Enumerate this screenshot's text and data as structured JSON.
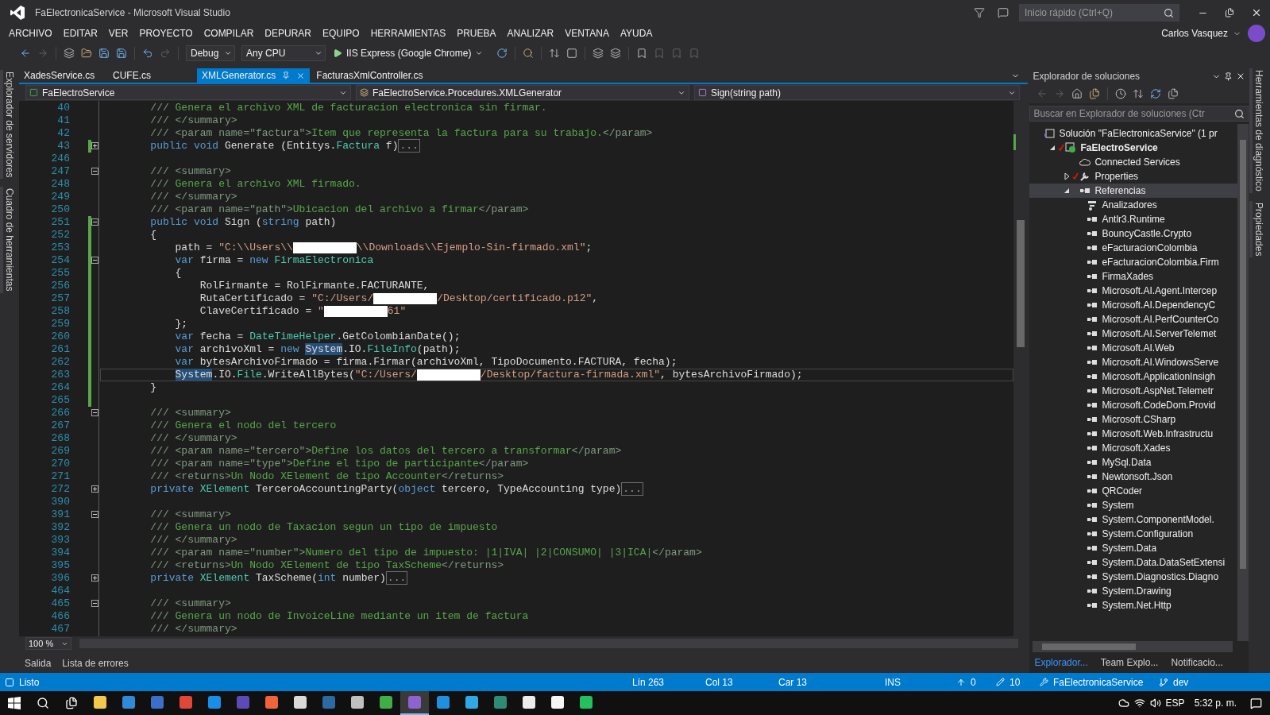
{
  "window": {
    "title": "FaElectronicaService - Microsoft Visual Studio",
    "quick_launch_placeholder": "Inicio rápido (Ctrl+Q)",
    "user": "Carlos Vasquez"
  },
  "menu": [
    "ARCHIVO",
    "EDITAR",
    "VER",
    "PROYECTO",
    "COMPILAR",
    "DEPURAR",
    "EQUIPO",
    "HERRAMIENTAS",
    "PRUEBA",
    "ANALIZAR",
    "VENTANA",
    "AYUDA"
  ],
  "toolbar": {
    "configuration": "Debug",
    "platform": "Any CPU",
    "run": "IIS Express (Google Chrome)"
  },
  "left_tabs": [
    "Explorador de servidores",
    "Cuadro de herramientas"
  ],
  "right_tabs": [
    "Herramientas de diagnóstico",
    "Propiedades"
  ],
  "doc_tabs": [
    {
      "label": "XadesService.cs",
      "selected": false
    },
    {
      "label": "CUFE.cs",
      "selected": false
    },
    {
      "label": "XMLGenerator.cs",
      "selected": true
    },
    {
      "label": "FacturasXmlController.cs",
      "selected": false
    }
  ],
  "nav_bar": {
    "project": "FaElectroService",
    "class": "FaElectroService.Procedures.XMLGenerator",
    "member": "Sign(string path)"
  },
  "editor": {
    "lines": [
      {
        "n": "40",
        "collapsible": false,
        "collapsed": false,
        "changed": false,
        "current": false,
        "tokens": [
          {
            "kind": "dt",
            "text": "///"
          },
          {
            "kind": "cm",
            "text": " Genera el archivo XML de facturacion electronica sin firmar."
          }
        ]
      },
      {
        "n": "41",
        "collapsible": false,
        "collapsed": false,
        "changed": false,
        "current": false,
        "tokens": [
          {
            "kind": "dt",
            "text": "/// </summary>"
          }
        ]
      },
      {
        "n": "42",
        "collapsible": false,
        "collapsed": false,
        "changed": false,
        "current": false,
        "tokens": [
          {
            "kind": "dt",
            "text": "/// <param name=\"factura\">"
          },
          {
            "kind": "cm",
            "text": "Item que representa la factura para su trabajo."
          },
          {
            "kind": "dt",
            "text": "</param>"
          }
        ]
      },
      {
        "n": "43",
        "collapsible": true,
        "collapsed": true,
        "changed": true,
        "current": false,
        "tokens": [
          {
            "kind": "kw",
            "text": "public void"
          },
          {
            "kind": "p",
            "text": " Generate (Entitys."
          },
          {
            "kind": "ty",
            "text": "Factura"
          },
          {
            "kind": "p",
            "text": " f)"
          },
          {
            "kind": "col",
            "text": "..."
          }
        ]
      },
      {
        "n": "246",
        "collapsible": false,
        "collapsed": false,
        "changed": false,
        "current": false
      },
      {
        "n": "247",
        "collapsible": true,
        "collapsed": false,
        "changed": false,
        "current": false,
        "tokens": [
          {
            "kind": "dt",
            "text": "/// <summary>"
          }
        ]
      },
      {
        "n": "248",
        "collapsible": false,
        "collapsed": false,
        "changed": false,
        "current": false,
        "tokens": [
          {
            "kind": "dt",
            "text": "///"
          },
          {
            "kind": "cm",
            "text": " Genera el archivo XML firmado."
          }
        ]
      },
      {
        "n": "249",
        "collapsible": false,
        "collapsed": false,
        "changed": false,
        "current": false,
        "tokens": [
          {
            "kind": "dt",
            "text": "/// </summary>"
          }
        ]
      },
      {
        "n": "250",
        "collapsible": false,
        "collapsed": false,
        "changed": false,
        "current": false,
        "tokens": [
          {
            "kind": "dt",
            "text": "/// <param name=\"path\">"
          },
          {
            "kind": "cm",
            "text": "Ubicacion del archivo a firmar"
          },
          {
            "kind": "dt",
            "text": "</param>"
          }
        ]
      },
      {
        "n": "251",
        "collapsible": true,
        "collapsed": false,
        "changed": true,
        "current": false,
        "tokens": [
          {
            "kind": "kw",
            "text": "public void"
          },
          {
            "kind": "p",
            "text": " Sign ("
          },
          {
            "kind": "kw",
            "text": "string"
          },
          {
            "kind": "p",
            "text": " path)"
          }
        ]
      },
      {
        "n": "252",
        "collapsible": false,
        "collapsed": false,
        "changed": true,
        "current": false,
        "tokens": [
          {
            "kind": "p",
            "text": "{"
          }
        ],
        "children": [
          {
            "n": "253",
            "collapsible": false,
            "collapsed": false,
            "changed": true,
            "current": false,
            "tokens": [
              {
                "kind": "p",
                "text": "path = "
              },
              {
                "kind": "st",
                "text": "\"C:\\\\Users\\\\"
              },
              {
                "kind": "redacted"
              },
              {
                "kind": "st",
                "text": "\\\\Downloads\\\\Ejemplo-Sin-firmado.xml\""
              },
              {
                "kind": "p",
                "text": ";"
              }
            ]
          },
          {
            "n": "254",
            "collapsible": true,
            "collapsed": false,
            "changed": true,
            "current": false,
            "tokens": [
              {
                "kind": "kw",
                "text": "var"
              },
              {
                "kind": "p",
                "text": " firma = "
              },
              {
                "kind": "kw",
                "text": "new"
              },
              {
                "kind": "ty",
                "text": " FirmaElectronica"
              }
            ]
          },
          {
            "n": "255",
            "collapsible": false,
            "collapsed": false,
            "changed": true,
            "current": false,
            "tokens": [
              {
                "kind": "p",
                "text": "{"
              }
            ],
            "children": [
              {
                "n": "256",
                "collapsible": false,
                "collapsed": false,
                "changed": true,
                "current": false,
                "tokens": [
                  {
                    "kind": "p",
                    "text": "RolFirmante = RolFirmante.FACTURANTE,"
                  }
                ]
              },
              {
                "n": "257",
                "collapsible": false,
                "collapsed": false,
                "changed": true,
                "current": false,
                "tokens": [
                  {
                    "kind": "p",
                    "text": "RutaCertificado = "
                  },
                  {
                    "kind": "st",
                    "text": "\"C:/Users/"
                  },
                  {
                    "kind": "redacted"
                  },
                  {
                    "kind": "st",
                    "text": "/Desktop/certificado.p12\""
                  },
                  {
                    "kind": "p",
                    "text": ","
                  }
                ]
              },
              {
                "n": "258",
                "collapsible": false,
                "collapsed": false,
                "changed": true,
                "current": false,
                "tokens": [
                  {
                    "kind": "p",
                    "text": "ClaveCertificado = "
                  },
                  {
                    "kind": "st",
                    "text": "\""
                  },
                  {
                    "kind": "redacted"
                  },
                  {
                    "kind": "st",
                    "text": "61\""
                  }
                ]
              }
            ]
          },
          {
            "n": "259",
            "collapsible": false,
            "collapsed": false,
            "changed": true,
            "current": false,
            "tokens": [
              {
                "kind": "p",
                "text": "};"
              }
            ]
          },
          {
            "n": "260",
            "collapsible": false,
            "collapsed": false,
            "changed": true,
            "current": false,
            "tokens": [
              {
                "kind": "kw",
                "text": "var"
              },
              {
                "kind": "p",
                "text": " fecha = "
              },
              {
                "kind": "ty",
                "text": "DateTimeHelper"
              },
              {
                "kind": "p",
                "text": ".GetColombianDate();"
              }
            ]
          },
          {
            "n": "261",
            "collapsible": false,
            "collapsed": false,
            "changed": true,
            "current": false,
            "tokens": [
              {
                "kind": "kw",
                "text": "var"
              },
              {
                "kind": "p",
                "text": " archivoXml = "
              },
              {
                "kind": "kw",
                "text": "new "
              },
              {
                "kind": "ref",
                "text": "System"
              },
              {
                "kind": "p",
                "text": ".IO."
              },
              {
                "kind": "ty",
                "text": "FileInfo"
              },
              {
                "kind": "p",
                "text": "(path);"
              }
            ]
          },
          {
            "n": "262",
            "collapsible": false,
            "collapsed": false,
            "changed": true,
            "current": false,
            "tokens": [
              {
                "kind": "kw",
                "text": "var"
              },
              {
                "kind": "p",
                "text": " bytesArchivoFirmado = firma.Firmar(archivoXml, TipoDocumento.FACTURA, fecha);"
              }
            ]
          },
          {
            "n": "263",
            "collapsible": false,
            "collapsed": false,
            "changed": true,
            "current": true,
            "tokens": [
              {
                "kind": "ref",
                "text": "System"
              },
              {
                "kind": "p",
                "text": ".IO."
              },
              {
                "kind": "ty",
                "text": "File"
              },
              {
                "kind": "p",
                "text": ".WriteAllBytes("
              },
              {
                "kind": "st",
                "text": "\"C:/Users/"
              },
              {
                "kind": "redacted"
              },
              {
                "kind": "st",
                "text": "/Desktop/factura-firmada.xml\""
              },
              {
                "kind": "p",
                "text": ", bytesArchivoFirmado);"
              }
            ]
          }
        ]
      },
      {
        "n": "264",
        "collapsible": false,
        "collapsed": false,
        "changed": true,
        "current": false,
        "tokens": [
          {
            "kind": "p",
            "text": "}"
          }
        ]
      },
      {
        "n": "265",
        "collapsible": false,
        "collapsed": false,
        "changed": true,
        "current": false
      },
      {
        "n": "266",
        "collapsible": true,
        "collapsed": false,
        "changed": false,
        "current": false,
        "tokens": [
          {
            "kind": "dt",
            "text": "/// <summary>"
          }
        ]
      },
      {
        "n": "267",
        "collapsible": false,
        "collapsed": false,
        "changed": false,
        "current": false,
        "tokens": [
          {
            "kind": "dt",
            "text": "///"
          },
          {
            "kind": "cm",
            "text": " Genera el nodo del tercero"
          }
        ]
      },
      {
        "n": "268",
        "collapsible": false,
        "collapsed": false,
        "changed": false,
        "current": false,
        "tokens": [
          {
            "kind": "dt",
            "text": "/// </summary>"
          }
        ]
      },
      {
        "n": "269",
        "collapsible": false,
        "collapsed": false,
        "changed": false,
        "current": false,
        "tokens": [
          {
            "kind": "dt",
            "text": "/// <param name=\"tercero\">"
          },
          {
            "kind": "cm",
            "text": "Define los datos del tercero a transformar"
          },
          {
            "kind": "dt",
            "text": "</param>"
          }
        ]
      },
      {
        "n": "270",
        "collapsible": false,
        "collapsed": false,
        "changed": false,
        "current": false,
        "tokens": [
          {
            "kind": "dt",
            "text": "/// <param name=\"type\">"
          },
          {
            "kind": "cm",
            "text": "Define el tipo de participante"
          },
          {
            "kind": "dt",
            "text": "</param>"
          }
        ]
      },
      {
        "n": "271",
        "collapsible": false,
        "collapsed": false,
        "changed": false,
        "current": false,
        "tokens": [
          {
            "kind": "dt",
            "text": "/// <returns>"
          },
          {
            "kind": "cm",
            "text": "Un Nodo XElement de tipo Accounter"
          },
          {
            "kind": "dt",
            "text": "</returns>"
          }
        ]
      },
      {
        "n": "272",
        "collapsible": true,
        "collapsed": true,
        "changed": false,
        "current": false,
        "tokens": [
          {
            "kind": "kw",
            "text": "private"
          },
          {
            "kind": "ty",
            "text": " XElement"
          },
          {
            "kind": "p",
            "text": " TerceroAccountingParty("
          },
          {
            "kind": "kw",
            "text": "object"
          },
          {
            "kind": "p",
            "text": " tercero, TypeAccounting type)"
          },
          {
            "kind": "col",
            "text": "..."
          }
        ]
      },
      {
        "n": "390",
        "collapsible": false,
        "collapsed": false,
        "changed": false,
        "current": false
      },
      {
        "n": "391",
        "collapsible": true,
        "collapsed": false,
        "changed": false,
        "current": false,
        "tokens": [
          {
            "kind": "dt",
            "text": "/// <summary>"
          }
        ]
      },
      {
        "n": "392",
        "collapsible": false,
        "collapsed": false,
        "changed": false,
        "current": false,
        "tokens": [
          {
            "kind": "dt",
            "text": "///"
          },
          {
            "kind": "cm",
            "text": " Genera un nodo de Taxacion segun un tipo de impuesto"
          }
        ]
      },
      {
        "n": "393",
        "collapsible": false,
        "collapsed": false,
        "changed": false,
        "current": false,
        "tokens": [
          {
            "kind": "dt",
            "text": "/// </summary>"
          }
        ]
      },
      {
        "n": "394",
        "collapsible": false,
        "collapsed": false,
        "changed": false,
        "current": false,
        "tokens": [
          {
            "kind": "dt",
            "text": "/// <param name=\"number\">"
          },
          {
            "kind": "cm",
            "text": "Numero del tipo de impuesto: |1|IVA| |2|CONSUMO| |3|ICA|"
          },
          {
            "kind": "dt",
            "text": "</param>"
          }
        ]
      },
      {
        "n": "395",
        "collapsible": false,
        "collapsed": false,
        "changed": false,
        "current": false,
        "tokens": [
          {
            "kind": "dt",
            "text": "/// <returns>"
          },
          {
            "kind": "cm",
            "text": "Un Nodo XElement de tipo TaxScheme"
          },
          {
            "kind": "dt",
            "text": "</returns>"
          }
        ]
      },
      {
        "n": "396",
        "collapsible": true,
        "collapsed": true,
        "changed": false,
        "current": false,
        "tokens": [
          {
            "kind": "kw",
            "text": "private"
          },
          {
            "kind": "ty",
            "text": " XElement"
          },
          {
            "kind": "p",
            "text": " TaxScheme("
          },
          {
            "kind": "kw",
            "text": "int"
          },
          {
            "kind": "p",
            "text": " number)"
          },
          {
            "kind": "col",
            "text": "..."
          }
        ]
      },
      {
        "n": "464",
        "collapsible": false,
        "collapsed": false,
        "changed": false,
        "current": false
      },
      {
        "n": "465",
        "collapsible": true,
        "collapsed": false,
        "changed": false,
        "current": false,
        "tokens": [
          {
            "kind": "dt",
            "text": "/// <summary>"
          }
        ]
      },
      {
        "n": "466",
        "collapsible": false,
        "collapsed": false,
        "changed": false,
        "current": false,
        "tokens": [
          {
            "kind": "dt",
            "text": "///"
          },
          {
            "kind": "cm",
            "text": " Genera un nodo de InvoiceLine mediante un item de factura"
          }
        ]
      },
      {
        "n": "467",
        "collapsible": false,
        "collapsed": false,
        "changed": false,
        "current": false,
        "tokens": [
          {
            "kind": "dt",
            "text": "/// </summary>"
          }
        ]
      }
    ],
    "zoom": "100 %"
  },
  "output_tabs": [
    {
      "label": "Salida",
      "selected": false
    },
    {
      "label": "Lista de errores",
      "selected": false
    }
  ],
  "solution_explorer": {
    "title": "Explorador de soluciones",
    "search_placeholder": "Buscar en Explorador de soluciones (Ctr",
    "tree": [
      {
        "label": "Solución \"FaElectronicaService\"  (1 pr",
        "kind": "solution",
        "selected": false,
        "children": [
          {
            "label": "FaElectroService",
            "kind": "project",
            "selected": false,
            "expanded": true,
            "modified": true,
            "children": [
              {
                "label": "Connected Services",
                "kind": "service",
                "selected": false,
                "modified": false
              },
              {
                "label": "Properties",
                "kind": "properties",
                "selected": false,
                "expanded": false,
                "modified": true
              },
              {
                "label": "Referencias",
                "kind": "references",
                "selected": true,
                "expanded": true,
                "modified": false,
                "children": [
                  {
                    "label": "Analizadores",
                    "kind": "analyzers",
                    "selected": false
                  },
                  {
                    "label": "Antlr3.Runtime",
                    "kind": "reference",
                    "selected": false
                  },
                  {
                    "label": "BouncyCastle.Crypto",
                    "kind": "reference",
                    "selected": false
                  },
                  {
                    "label": "eFacturacionColombia",
                    "kind": "reference",
                    "selected": false
                  },
                  {
                    "label": "eFacturacionColombia.Firm",
                    "kind": "reference",
                    "selected": false
                  },
                  {
                    "label": "FirmaXades",
                    "kind": "reference",
                    "selected": false
                  },
                  {
                    "label": "Microsoft.AI.Agent.Intercep",
                    "kind": "reference",
                    "selected": false
                  },
                  {
                    "label": "Microsoft.AI.DependencyC",
                    "kind": "reference",
                    "selected": false
                  },
                  {
                    "label": "Microsoft.AI.PerfCounterCo",
                    "kind": "reference",
                    "selected": false
                  },
                  {
                    "label": "Microsoft.AI.ServerTelemet",
                    "kind": "reference",
                    "selected": false
                  },
                  {
                    "label": "Microsoft.AI.Web",
                    "kind": "reference",
                    "selected": false
                  },
                  {
                    "label": "Microsoft.AI.WindowsServe",
                    "kind": "reference",
                    "selected": false
                  },
                  {
                    "label": "Microsoft.ApplicationInsigh",
                    "kind": "reference",
                    "selected": false
                  },
                  {
                    "label": "Microsoft.AspNet.Telemetr",
                    "kind": "reference",
                    "selected": false
                  },
                  {
                    "label": "Microsoft.CodeDom.Provid",
                    "kind": "reference",
                    "selected": false
                  },
                  {
                    "label": "Microsoft.CSharp",
                    "kind": "reference",
                    "selected": false
                  },
                  {
                    "label": "Microsoft.Web.Infrastructu",
                    "kind": "reference",
                    "selected": false
                  },
                  {
                    "label": "Microsoft.Xades",
                    "kind": "reference",
                    "selected": false
                  },
                  {
                    "label": "MySql.Data",
                    "kind": "reference",
                    "selected": false
                  },
                  {
                    "label": "Newtonsoft.Json",
                    "kind": "reference",
                    "selected": false
                  },
                  {
                    "label": "QRCoder",
                    "kind": "reference",
                    "selected": false
                  },
                  {
                    "label": "System",
                    "kind": "reference",
                    "selected": false
                  },
                  {
                    "label": "System.ComponentModel.",
                    "kind": "reference",
                    "selected": false
                  },
                  {
                    "label": "System.Configuration",
                    "kind": "reference",
                    "selected": false
                  },
                  {
                    "label": "System.Data",
                    "kind": "reference",
                    "selected": false
                  },
                  {
                    "label": "System.Data.DataSetExtensi",
                    "kind": "reference",
                    "selected": false
                  },
                  {
                    "label": "System.Diagnostics.Diagno",
                    "kind": "reference",
                    "selected": false
                  },
                  {
                    "label": "System.Drawing",
                    "kind": "reference",
                    "selected": false
                  },
                  {
                    "label": "System.Net.Http",
                    "kind": "reference",
                    "selected": false
                  }
                ]
              }
            ]
          }
        ]
      }
    ],
    "tabs": [
      {
        "label": "Explorador...",
        "selected": true
      },
      {
        "label": "Team Explo...",
        "selected": false
      },
      {
        "label": "Notificacio...",
        "selected": false
      }
    ]
  },
  "status_bar": {
    "message": "Listo",
    "line": "Lín 263",
    "column": "Col 13",
    "char": "Car 13",
    "mode": "INS",
    "pushes": "0",
    "edits": "10",
    "repository": "FaElectronicaService",
    "branch": "dev"
  },
  "taskbar": {
    "apps": [
      {
        "color": "#f2c94c",
        "selected": false
      },
      {
        "color": "#2f8ad8",
        "selected": false
      },
      {
        "color": "#3b6fc9",
        "selected": false
      },
      {
        "color": "#e0463a",
        "selected": false
      },
      {
        "color": "#1a8ee6",
        "selected": false
      },
      {
        "color": "#5b4bb7",
        "selected": false
      },
      {
        "color": "#f0643c",
        "selected": false
      },
      {
        "color": "#d9d9d9",
        "selected": false
      },
      {
        "color": "#2b6aa3",
        "selected": false
      },
      {
        "color": "#bfbfbf",
        "selected": false
      },
      {
        "color": "#3fae49",
        "selected": false
      },
      {
        "color": "#8d63cf",
        "selected": true
      },
      {
        "color": "#1f90e0",
        "selected": false
      },
      {
        "color": "#2ea8e6",
        "selected": false
      },
      {
        "color": "#2e8b75",
        "selected": false
      },
      {
        "color": "#ececec",
        "selected": false
      },
      {
        "color": "#f5f5f5",
        "selected": false
      },
      {
        "color": "#22c15e",
        "selected": false
      }
    ],
    "language": "ESP",
    "time": "5:32 p. m."
  }
}
